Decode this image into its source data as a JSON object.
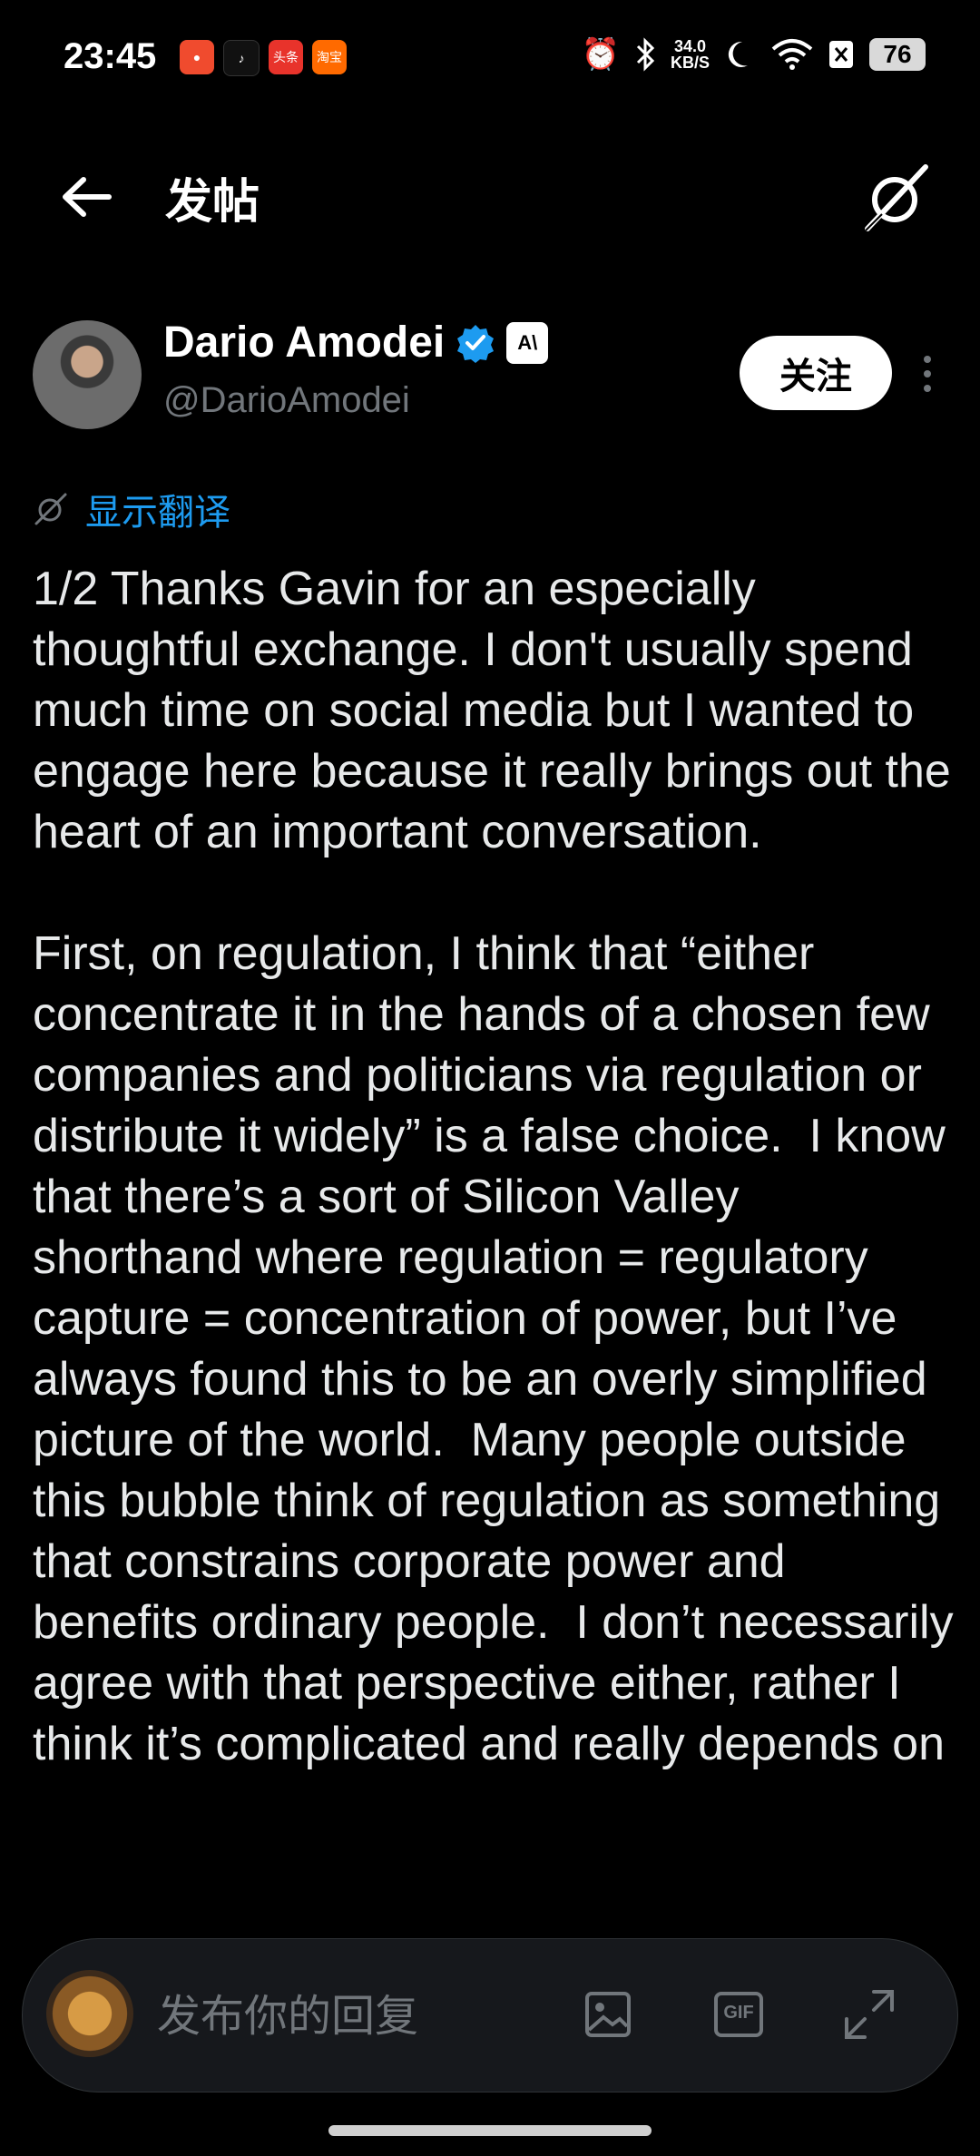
{
  "status_bar": {
    "time": "23:45",
    "speed_value": "34.0",
    "speed_unit": "KB/S",
    "battery": "76",
    "app_icons": [
      {
        "name": "app-icon-1",
        "text": "",
        "color": "#f04b2e"
      },
      {
        "name": "app-icon-douyin",
        "text": "♪",
        "color": "#111111"
      },
      {
        "name": "app-icon-toutiao",
        "text": "头条",
        "color": "#e8332b"
      },
      {
        "name": "app-icon-taobao",
        "text": "淘宝",
        "color": "#ff6a00"
      }
    ]
  },
  "header": {
    "title": "发帖"
  },
  "post": {
    "author_name": "Dario Amodei",
    "handle": "@DarioAmodei",
    "affiliation_badge": "A\\",
    "follow_label": "关注",
    "translate_label": "显示翻译",
    "text": "1/2 Thanks Gavin for an especially thoughtful exchange. I don't usually spend much time on social media but I wanted to engage here because it really brings out the heart of an important conversation.\n\nFirst, on regulation, I think that “either concentrate it in the hands of a chosen few companies and politicians via regulation or distribute it widely” is a false choice.  I know that there’s a sort of Silicon Valley shorthand where regulation = regulatory capture = concentration of power, but I’ve always found this to be an overly simplified picture of the world.  Many people outside this bubble think of regulation as something that constrains corporate power and benefits ordinary people.  I don’t necessarily agree with that perspective either, rather I think it’s complicated and really depends on"
  },
  "reply_bar": {
    "placeholder": "发布你的回复",
    "gif_label": "GIF"
  },
  "colors": {
    "background": "#000000",
    "text": "#e7e9ea",
    "muted": "#71767b",
    "link": "#1d9bf0",
    "verified": "#1d9bf0"
  }
}
